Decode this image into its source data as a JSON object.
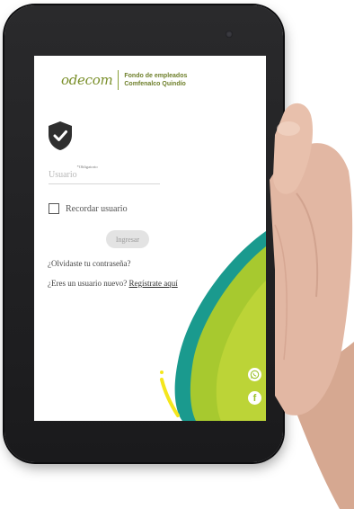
{
  "logo": {
    "word": "odecom",
    "line1": "Fondo de empleados",
    "line2": "Comfenalco Quindío"
  },
  "login": {
    "username_placeholder": "Usuario",
    "username_required": "*Obligatorio",
    "remember_label": "Recordar usuario",
    "submit_label": "Ingresar",
    "forgot_link": "¿Olvidaste tu contraseña?",
    "register_prompt": "¿Eres un usuario nuevo?",
    "register_link": "Regístrate aquí"
  },
  "social": {
    "whatsapp_icon": "whatsapp-icon",
    "facebook_icon": "facebook-icon",
    "facebook_glyph": "f"
  },
  "colors": {
    "brand_green": "#9bc12a",
    "brand_teal": "#1a9a8e",
    "brand_yellow": "#f4e61c",
    "shield": "#2f2f2f"
  }
}
